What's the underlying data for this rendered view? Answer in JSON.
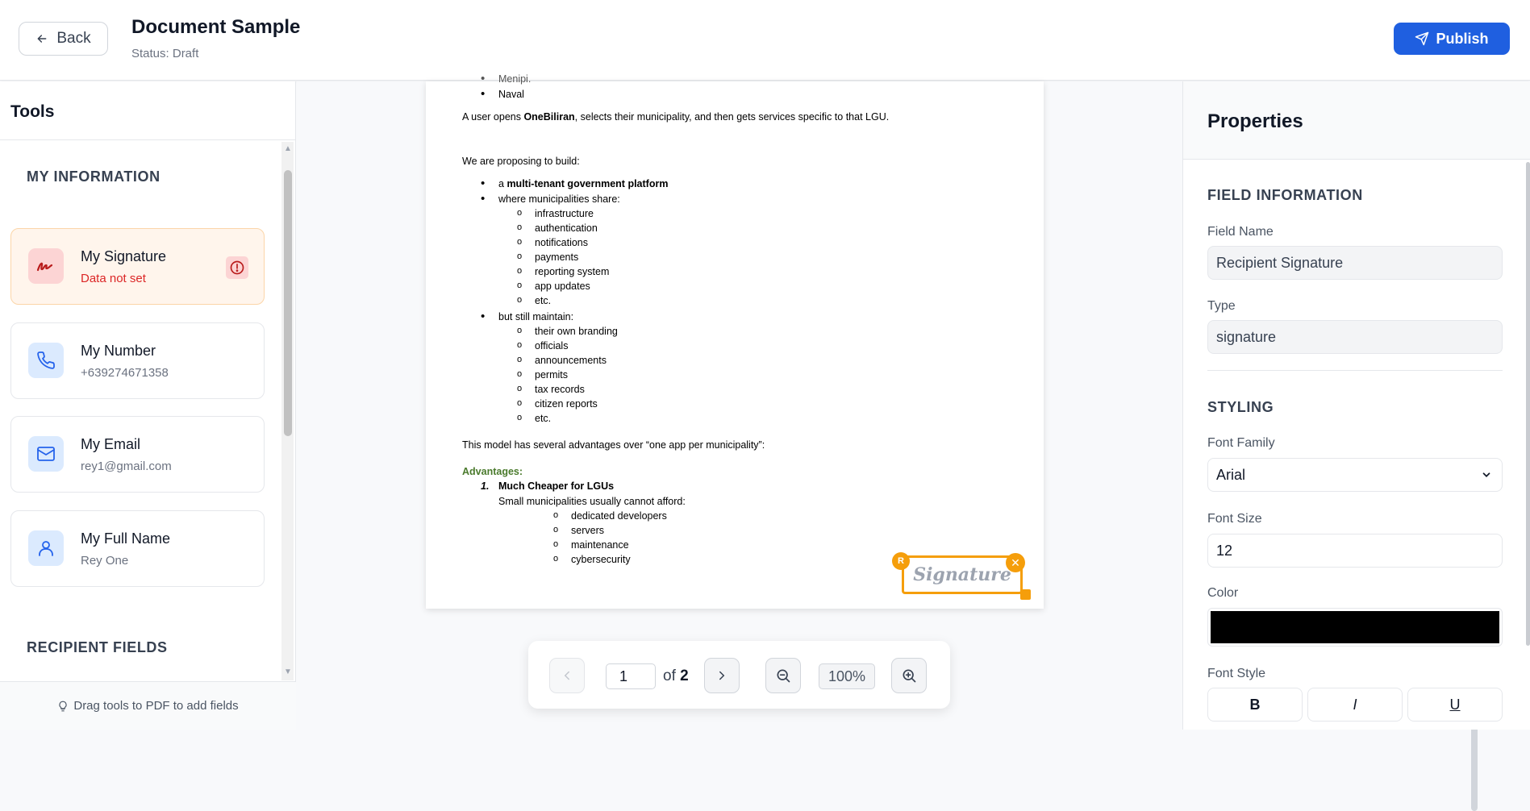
{
  "header": {
    "back_label": "Back",
    "title": "Document Sample",
    "status": "Status: Draft",
    "publish_label": "Publish"
  },
  "tools": {
    "title": "Tools",
    "my_info_label": "MY INFORMATION",
    "recipient_fields_label": "RECIPIENT FIELDS",
    "footer": "Drag tools to PDF to add fields",
    "items": [
      {
        "title": "My Signature",
        "sub": "Data not set",
        "icon": "signature-icon"
      },
      {
        "title": "My Number",
        "sub": "+639274671358",
        "icon": "phone-icon"
      },
      {
        "title": "My Email",
        "sub": "rey1@gmail.com",
        "icon": "mail-icon"
      },
      {
        "title": "My Full Name",
        "sub": "Rey One",
        "icon": "user-icon"
      }
    ]
  },
  "document": {
    "top_partial": "Menipi.",
    "naval": "Naval",
    "p1_pre": "A user opens ",
    "p1_bold": "OneBiliran",
    "p1_post": ", selects their municipality, and then gets services specific to that LGU.",
    "p2": "We are proposing to build:",
    "b1_pre": "a ",
    "b1_bold": "multi-tenant government platform",
    "b2": "where municipalities share:",
    "share": [
      "infrastructure",
      "authentication",
      "notifications",
      "payments",
      "reporting system",
      "app updates",
      "etc."
    ],
    "b3": "but still maintain:",
    "maintain": [
      "their own branding",
      "officials",
      "announcements",
      "permits",
      "tax records",
      "citizen reports",
      "etc."
    ],
    "p3": "This model has several advantages over “one app per municipality”:",
    "adv_label": "Advantages:",
    "adv1_num": "1.",
    "adv1_title": "Much Cheaper for LGUs",
    "adv1_sub": "Small municipalities usually cannot afford:",
    "cannot": [
      "dedicated developers",
      "servers",
      "maintenance",
      "cybersecurity"
    ],
    "sig_placeholder": "Signature",
    "sig_badge": "R"
  },
  "pager": {
    "page": "1",
    "of_label": "of",
    "total": "2",
    "zoom": "100%"
  },
  "properties": {
    "title": "Properties",
    "field_info_label": "FIELD INFORMATION",
    "field_name_label": "Field Name",
    "field_name": "Recipient Signature",
    "type_label": "Type",
    "type": "signature",
    "styling_label": "STYLING",
    "font_family_label": "Font Family",
    "font_family": "Arial",
    "font_size_label": "Font Size",
    "font_size": "12",
    "color_label": "Color",
    "color_value": "#000000",
    "font_style_label": "Font Style",
    "bold": "B",
    "italic": "I",
    "underline": "U"
  },
  "colors": {
    "accent": "#1f5fe0",
    "signature_highlight": "#f59e0b",
    "warning": "#dc2626"
  }
}
